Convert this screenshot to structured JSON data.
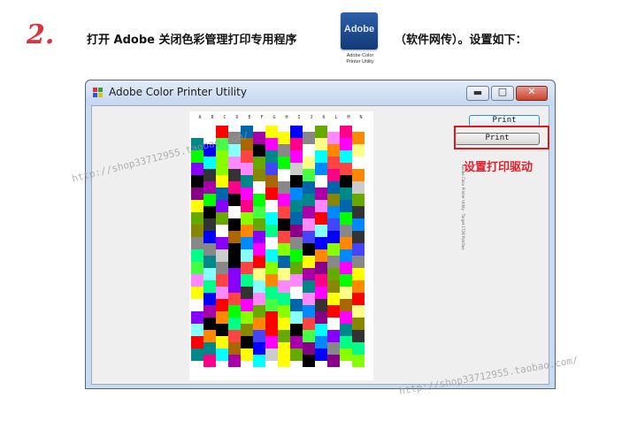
{
  "step": "2.",
  "instruction": {
    "before": "打开 Adobe 关闭色彩管理打印专用程序",
    "after": "（软件网传）。设置如下："
  },
  "adobe_icon": {
    "text": "Adobe",
    "caption_line1": "Adobe Color",
    "caption_line2": "Printer Utility"
  },
  "window": {
    "title": "Adobe Color Printer Utility",
    "minimize": "▬",
    "maximize": "□",
    "close": "✕"
  },
  "chart": {
    "columns": [
      "A",
      "B",
      "C",
      "D",
      "E",
      "F",
      "G",
      "H",
      "I",
      "J",
      "K",
      "L",
      "M",
      "N"
    ],
    "side_note": "Adobe Color Printer Utility · Target 1728 Patches",
    "palette": [
      "#ff00ff",
      "#00ffff",
      "#ffff00",
      "#00ff00",
      "#ff0000",
      "#0000ff",
      "#ff8800",
      "#8800ff",
      "#00ff88",
      "#ff0088",
      "#88ff00",
      "#0088ff",
      "#888888",
      "#000000",
      "#ffffff",
      "#880088",
      "#008888",
      "#888800",
      "#cccccc",
      "#ff88ff",
      "#88ffff",
      "#ffff88",
      "#ff4444",
      "#44ff44",
      "#4444ff",
      "#aa6600",
      "#66aa00",
      "#0066aa",
      "#333333",
      "#aa00aa"
    ]
  },
  "buttons": {
    "print_primary": "Print",
    "print_driver": "Print"
  },
  "annotation": "设置打印驱动",
  "watermarks": [
    "http://shop33712955.taobao.com/",
    "http://shop33712955.taobao.com/"
  ]
}
